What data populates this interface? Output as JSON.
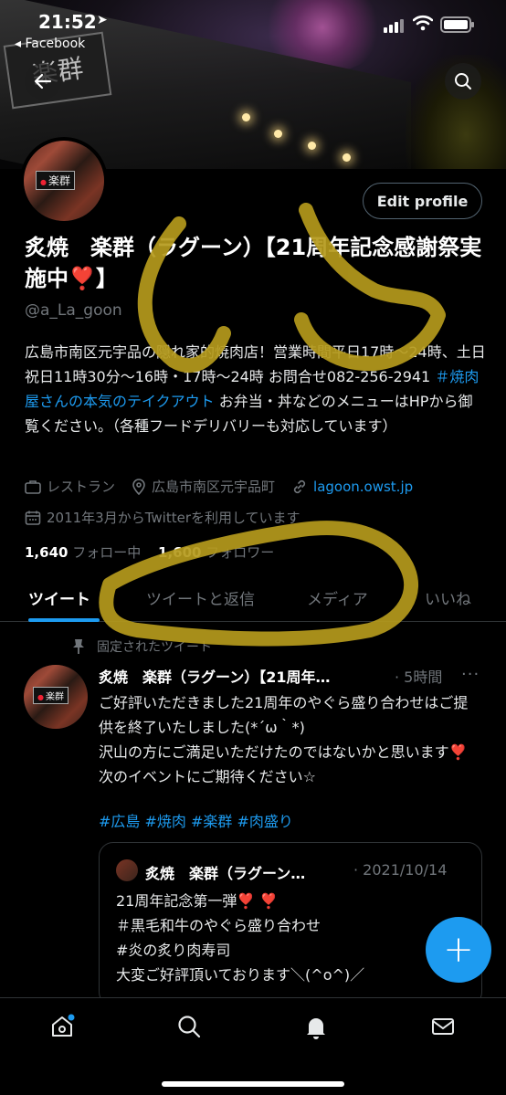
{
  "status_bar": {
    "time": "21:52",
    "back_app": "◂ Facebook"
  },
  "header": {
    "banner_sign": "楽群",
    "avatar_sign": "楽群"
  },
  "profile": {
    "edit_label": "Edit profile",
    "name": "炙焼　楽群（ラグーン）【21周年記念感謝祭実施中❣️】",
    "handle": "@a_La_goon",
    "bio_before_tag": "広島市南区元宇品の隠れ家的焼肉店！営業時間平日17時〜24時、土日祝日11時30分〜16時・17時〜24時 お問合せ082-256-2941 ",
    "bio_tag": "＃焼肉屋さんの本気のテイクアウト",
    "bio_after_tag": " お弁当・丼などのメニューはHPから御覧ください。（各種フードデリバリーも対応しています）",
    "category": "レストラン",
    "location": "広島市南区元宇品町",
    "website": "lagoon.owst.jp",
    "joined": "2011年3月からTwitterを利用しています",
    "following_count": "1,640",
    "following_label": "フォロー中",
    "followers_count": "1,600",
    "followers_label": "フォロワー"
  },
  "tabs": [
    {
      "label": "ツイート"
    },
    {
      "label": "ツイートと返信"
    },
    {
      "label": "メディア"
    },
    {
      "label": "いいね"
    }
  ],
  "tweet": {
    "pinned_label": "固定されたツイート",
    "name": "炙焼　楽群（ラグーン）【21周年…",
    "time": "· 5時間",
    "more": "···",
    "body": "ご好評いただきました21周年のやぐら盛り合わせはご提供を終了いたしました(*´ω｀*)\n沢山の方にご満足いただけたのではないかと思います❣️\n次のイベントにご期待ください☆",
    "tags": "#広島 #焼肉 #楽群 #肉盛り",
    "quote": {
      "name": "炙焼　楽群（ラグーン…",
      "date": "· 2021/10/14",
      "body": "21周年記念第一弾❣️ ❣️\n＃黒毛和牛のやぐら盛り合わせ\n#炎の炙り肉寿司\n大変ご好評頂いております＼(^o^)／"
    }
  },
  "fab_label": "+",
  "icons": {
    "back": "arrow-left-icon",
    "search": "search-icon",
    "category": "briefcase-icon",
    "location": "location-pin-icon",
    "website": "link-icon",
    "joined": "calendar-icon",
    "pin": "pin-icon",
    "nav_home": "home-icon",
    "nav_search": "search-icon",
    "nav_notifications": "bell-icon",
    "nav_messages": "mail-icon"
  },
  "colors": {
    "accent": "#1d9bf0",
    "background": "#000000",
    "secondary_text": "#71767b",
    "scribble": "#b59a1c"
  }
}
